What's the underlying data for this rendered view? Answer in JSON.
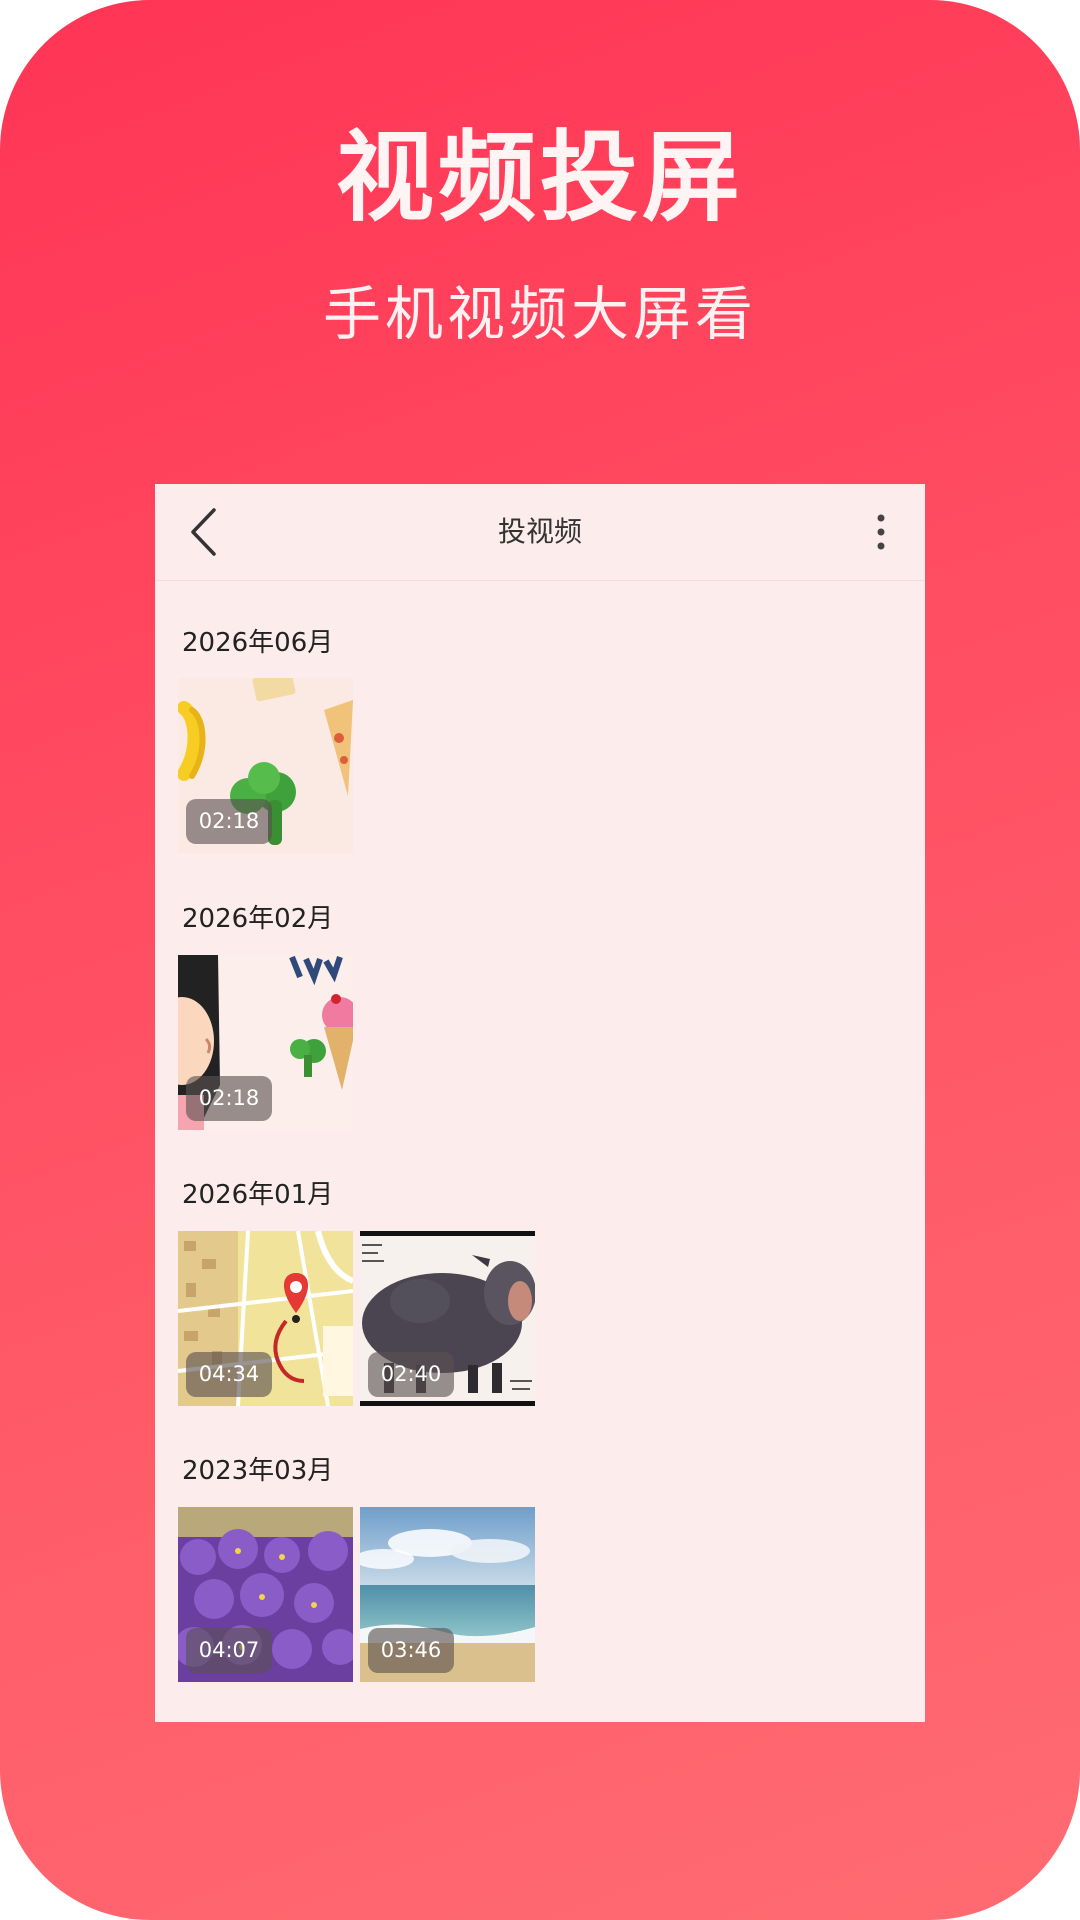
{
  "promo": {
    "title": "视频投屏",
    "subtitle": "手机视频大屏看"
  },
  "app": {
    "title": "投视频",
    "back_icon": "back-arrow-icon",
    "more_icon": "more-vertical-icon"
  },
  "sections": [
    {
      "date": "2026年06月",
      "videos": [
        {
          "duration": "02:18"
        }
      ]
    },
    {
      "date": "2026年02月",
      "videos": [
        {
          "duration": "02:18"
        }
      ]
    },
    {
      "date": "2026年01月",
      "videos": [
        {
          "duration": "04:34"
        },
        {
          "duration": "02:40"
        }
      ]
    },
    {
      "date": "2023年03月",
      "videos": [
        {
          "duration": "04:07"
        },
        {
          "duration": "03:46"
        }
      ]
    }
  ],
  "colors": {
    "background_gradient_start": "#ff3455",
    "background_gradient_end": "#ff6b72",
    "panel": "#fdecec"
  }
}
